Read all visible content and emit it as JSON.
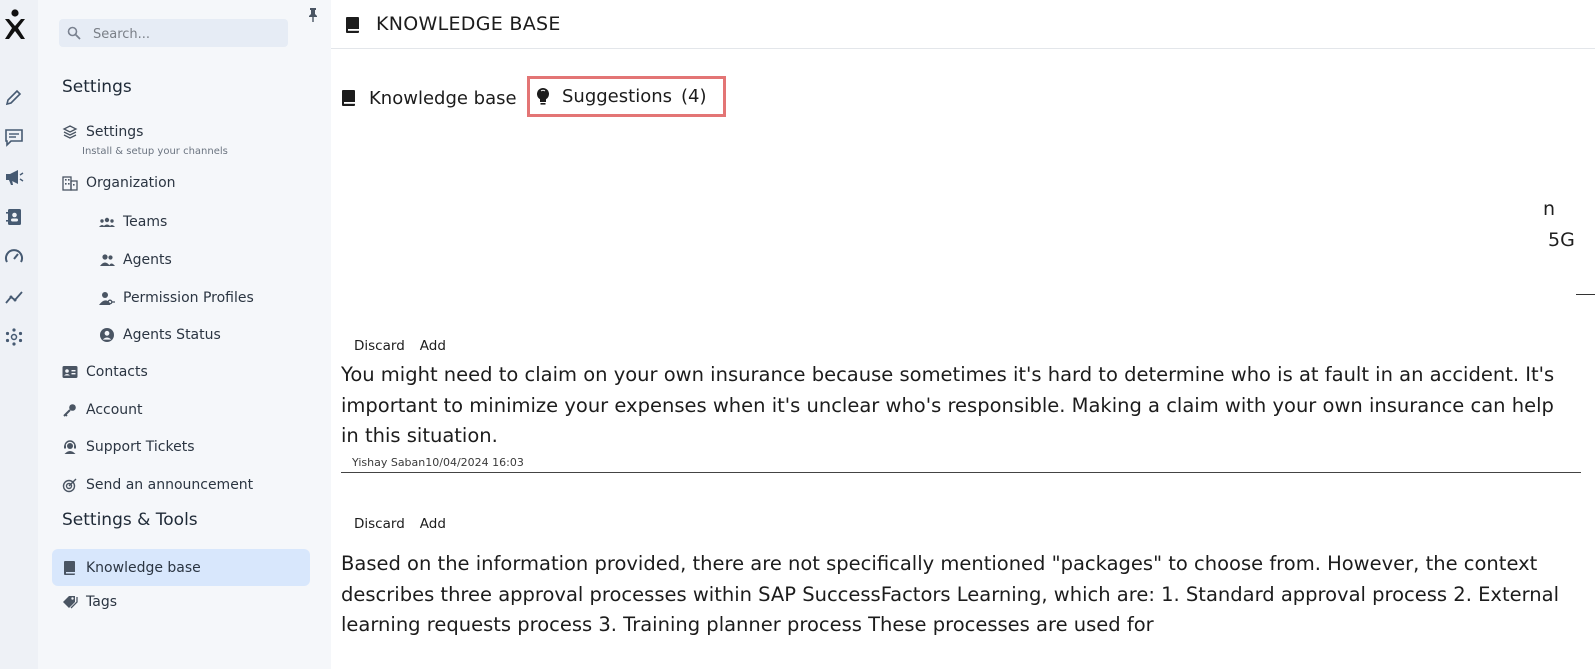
{
  "rail": {
    "icons": [
      "logo-icon",
      "pencil-icon",
      "chat-icon",
      "megaphone-icon",
      "contacts-icon",
      "dashboard-icon",
      "analytics-icon",
      "integrations-icon"
    ]
  },
  "sidebar": {
    "search_placeholder": "Search...",
    "section1_title": "Settings",
    "section2_title": "Settings & Tools",
    "items": {
      "settings": "Settings",
      "settings_sub": "Install & setup your channels",
      "organization": "Organization",
      "teams": "Teams",
      "agents": "Agents",
      "permission_profiles": "Permission Profiles",
      "agents_status": "Agents Status",
      "contacts": "Contacts",
      "account": "Account",
      "support_tickets": "Support Tickets",
      "send_announcement": "Send an announcement",
      "knowledge_base": "Knowledge base",
      "tags": "Tags"
    },
    "active_item": "knowledge_base",
    "active_color": "#d8e7fc"
  },
  "header": {
    "title": "KNOWLEDGE BASE"
  },
  "tabs": {
    "knowledge_base": "Knowledge base",
    "suggestions": "Suggestions",
    "suggestions_count": "(4)",
    "highlight_color": "#e37575"
  },
  "stray_text": {
    "line1": "n",
    "line2": "5G"
  },
  "suggestions": [
    {
      "discard_label": "Discard",
      "add_label": "Add",
      "text": "You might need to claim on your own insurance because sometimes it's hard to determine who is at fault in an accident. It's important to minimize your expenses when it's unclear who's responsible. Making a claim with your own insurance can help in this situation.",
      "author": "Yishay Saban",
      "timestamp": "10/04/2024 16:03"
    },
    {
      "discard_label": "Discard",
      "add_label": "Add",
      "text": "Based on the information provided, there are not specifically mentioned \"packages\" to choose from. However, the context describes three approval processes within SAP SuccessFactors Learning, which are: 1. Standard approval process 2. External learning requests process 3. Training planner process These processes are used for",
      "author": "",
      "timestamp": ""
    }
  ]
}
